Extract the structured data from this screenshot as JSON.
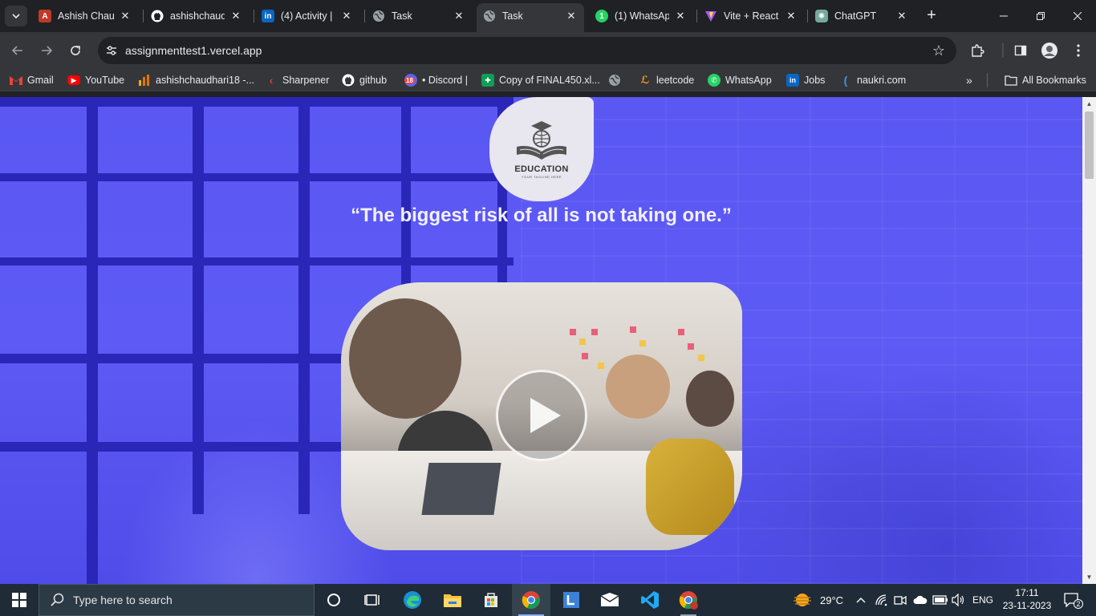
{
  "browser": {
    "tabs": [
      {
        "title": "Ashish Chau",
        "favicon": "profile-avatar-icon",
        "color": "#c0392b",
        "active": false
      },
      {
        "title": "ashishchaudl",
        "favicon": "github-icon",
        "color": "#ffffff",
        "active": false
      },
      {
        "title": "(4) Activity | ",
        "favicon": "linkedin-icon",
        "color": "#0a66c2",
        "active": false
      },
      {
        "title": "Task",
        "favicon": "globe-icon",
        "color": "#9aa0a6",
        "active": false
      },
      {
        "title": "Task",
        "favicon": "globe-icon",
        "color": "#9aa0a6",
        "active": true
      },
      {
        "title": "(1) WhatsAp",
        "favicon": "whatsapp-icon",
        "color": "#25d366",
        "active": false
      },
      {
        "title": "Vite + React",
        "favicon": "vite-icon",
        "color": "#a259ff",
        "active": false
      },
      {
        "title": "ChatGPT",
        "favicon": "chatgpt-icon",
        "color": "#74aa9c",
        "active": false
      }
    ],
    "url": "assignmenttest1.vercel.app",
    "bookmarks": [
      {
        "label": "Gmail",
        "icon": "gmail-icon"
      },
      {
        "label": "YouTube",
        "icon": "youtube-icon"
      },
      {
        "label": "ashishchaudhari18 -...",
        "icon": "analytics-icon"
      },
      {
        "label": "Sharpener",
        "icon": "sharpener-icon"
      },
      {
        "label": "github",
        "icon": "github-icon"
      },
      {
        "label": "• Discord |",
        "icon": "discord-icon",
        "badge": "18"
      },
      {
        "label": "Copy of FINAL450.xl...",
        "icon": "sheets-icon"
      },
      {
        "label": "",
        "icon": "globe-icon"
      },
      {
        "label": "leetcode",
        "icon": "leetcode-icon"
      },
      {
        "label": "WhatsApp",
        "icon": "whatsapp-icon"
      },
      {
        "label": "Jobs",
        "icon": "linkedin-icon"
      },
      {
        "label": "naukri.com",
        "icon": "naukri-icon"
      }
    ],
    "all_bookmarks": "All Bookmarks"
  },
  "page": {
    "logo": {
      "brand": "EDUCATION",
      "tagline": "YOUR TAGLINE HERE"
    },
    "quote": "“The biggest risk of all is not taking one.”",
    "accent": "#6461f6"
  },
  "taskbar": {
    "search_placeholder": "Type here to search",
    "weather": "29°C",
    "language": "ENG",
    "time": "17:11",
    "date": "23-11-2023",
    "notifications": "2"
  }
}
